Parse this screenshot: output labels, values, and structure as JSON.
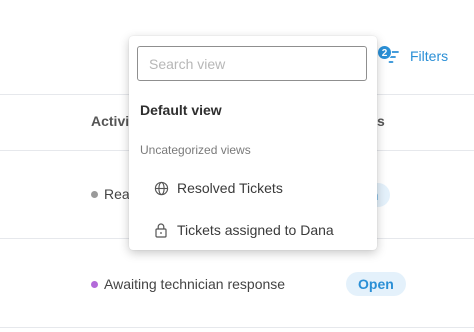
{
  "toolbar": {
    "filters_label": "Filters",
    "filters_badge": "2",
    "filter_icon": "filter-lines-icon"
  },
  "table": {
    "headers": {
      "activity": "Activit",
      "status": "s"
    },
    "rows": [
      {
        "activity": "Rea",
        "activity_color": "#9a9a9a",
        "status": "en"
      },
      {
        "activity": "Awaiting technician response",
        "activity_color": "#b36ad9",
        "status": "Open"
      }
    ]
  },
  "views_dropdown": {
    "search_placeholder": "Search view",
    "search_value": "",
    "default_view": "Default view",
    "section_label": "Uncategorized views",
    "items": [
      {
        "label": "Resolved Tickets",
        "icon": "globe-icon"
      },
      {
        "label": "Tickets assigned to Dana",
        "icon": "lock-icon"
      }
    ]
  },
  "colors": {
    "accent": "#2a8fd6",
    "pill_bg": "#e4f1fb"
  }
}
